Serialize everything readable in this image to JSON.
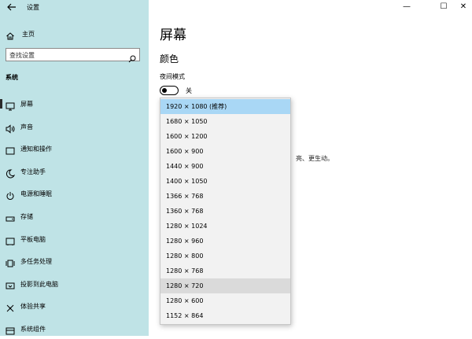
{
  "window": {
    "title": "设置",
    "minimize_glyph": "—",
    "maximize_glyph": "☐",
    "close_glyph": "✕"
  },
  "sidebar": {
    "home": "主页",
    "search_placeholder": "查找设置",
    "section": "系统",
    "items": [
      {
        "label": "屏幕",
        "icon": "monitor-icon",
        "selected": true
      },
      {
        "label": "声音",
        "icon": "speaker-icon"
      },
      {
        "label": "通知和操作",
        "icon": "notification-icon"
      },
      {
        "label": "专注助手",
        "icon": "moon-icon"
      },
      {
        "label": "电源和睡眠",
        "icon": "power-icon"
      },
      {
        "label": "存储",
        "icon": "storage-icon"
      },
      {
        "label": "平板电脑",
        "icon": "tablet-icon"
      },
      {
        "label": "多任务处理",
        "icon": "multitask-icon"
      },
      {
        "label": "投影到此电脑",
        "icon": "projector-icon"
      },
      {
        "label": "体验共享",
        "icon": "share-icon"
      },
      {
        "label": "系统组件",
        "icon": "components-icon"
      }
    ]
  },
  "main": {
    "title": "屏幕",
    "color_heading": "颜色",
    "night_mode_label": "夜间模式",
    "toggle_state": "关",
    "toggle_on": false,
    "partial_text": "亮、更生动。"
  },
  "resolution_dropdown": {
    "options": [
      "1920 × 1080 (推荐)",
      "1680 × 1050",
      "1600 × 1200",
      "1600 × 900",
      "1440 × 900",
      "1400 × 1050",
      "1366 × 768",
      "1360 × 768",
      "1280 × 1024",
      "1280 × 960",
      "1280 × 800",
      "1280 × 768",
      "1280 × 720",
      "1280 × 600",
      "1152 × 864"
    ],
    "selected": "1920 × 1080 (推荐)",
    "hovered": "1280 × 720"
  },
  "colors": {
    "sidebar_bg": "#bfe3e6",
    "selected_option": "#a9d7f5",
    "hover_option": "#dadada"
  }
}
